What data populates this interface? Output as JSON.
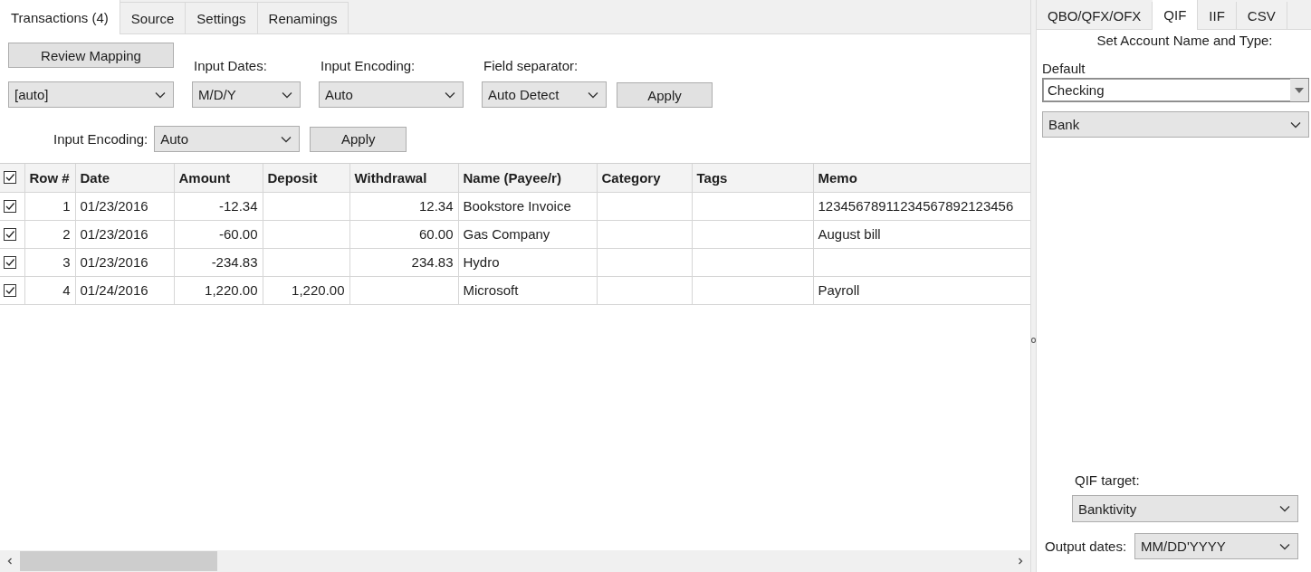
{
  "tabs": [
    {
      "label": "Transactions (4)",
      "selected": true
    },
    {
      "label": "Source",
      "selected": false
    },
    {
      "label": "Settings",
      "selected": false
    },
    {
      "label": "Renamings",
      "selected": false
    }
  ],
  "toolbar": {
    "review_button": "Review Mapping",
    "mapping_combo": "[auto]",
    "fields": [
      {
        "label": "Input Dates:",
        "value": "M/D/Y"
      },
      {
        "label": "Input Encoding:",
        "value": "Auto"
      },
      {
        "label": "Field separator:",
        "value": "Auto Detect"
      }
    ],
    "apply_button": "Apply"
  },
  "encoding_row": {
    "label": "Input Encoding:",
    "value": "Auto",
    "apply_button": "Apply"
  },
  "table": {
    "all_checked": true,
    "columns": [
      {
        "label": "Row #",
        "numeric": true
      },
      {
        "label": "Date",
        "numeric": false
      },
      {
        "label": "Amount",
        "numeric": true
      },
      {
        "label": "Deposit",
        "numeric": true
      },
      {
        "label": "Withdrawal",
        "numeric": true
      },
      {
        "label": "Name (Payee/r)",
        "numeric": false
      },
      {
        "label": "Category"
      },
      {
        "label": "Tags"
      },
      {
        "label": "Memo",
        "numeric": false
      }
    ],
    "rows": [
      {
        "checked": true,
        "cells": [
          "1",
          "01/23/2016",
          "-12.34",
          "",
          "12.34",
          "Bookstore Invoice",
          "",
          "",
          "12345678911234567892123456"
        ]
      },
      {
        "checked": true,
        "cells": [
          "2",
          "01/23/2016",
          "-60.00",
          "",
          "60.00",
          "Gas Company",
          "",
          "",
          "August bill"
        ]
      },
      {
        "checked": true,
        "cells": [
          "3",
          "01/23/2016",
          "-234.83",
          "",
          "234.83",
          "Hydro",
          "",
          "",
          ""
        ]
      },
      {
        "checked": true,
        "cells": [
          "4",
          "01/24/2016",
          "1,220.00",
          "1,220.00",
          "",
          "Microsoft",
          "",
          "",
          "Payroll"
        ]
      }
    ]
  },
  "right_panel": {
    "tabs": [
      {
        "label": "QBO/QFX/OFX",
        "selected": false
      },
      {
        "label": "QIF",
        "selected": true
      },
      {
        "label": "IIF",
        "selected": false
      },
      {
        "label": "CSV",
        "selected": false
      }
    ],
    "heading": "Set Account Name and Type:",
    "default_label": "Default",
    "account_name": "Checking",
    "account_type": "Bank",
    "qif_target_label": "QIF target:",
    "qif_target": "Banktivity",
    "output_dates_label": "Output dates:",
    "output_dates": "MM/DD'YYYY"
  }
}
